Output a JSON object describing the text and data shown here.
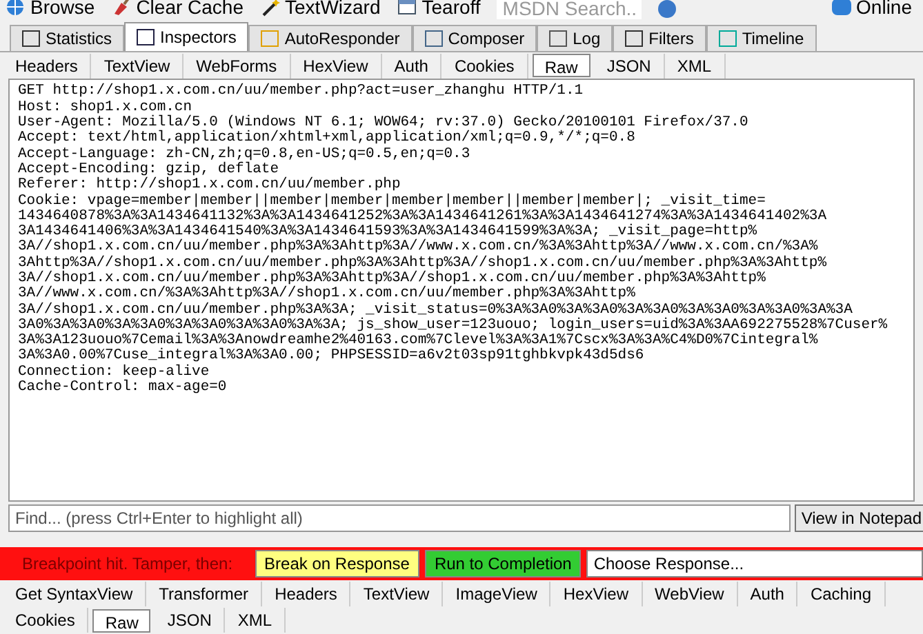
{
  "toolbar": [
    {
      "label": "Browse",
      "kind": "globe"
    },
    {
      "label": "Clear Cache",
      "kind": "broom"
    },
    {
      "label": "TextWizard",
      "kind": "wand"
    },
    {
      "label": "Tearoff",
      "kind": "window"
    }
  ],
  "search": {
    "placeholder": "MSDN Search..."
  },
  "online": {
    "label": "Online"
  },
  "main_tabs": [
    {
      "label": "Statistics",
      "selected": false
    },
    {
      "label": "Inspectors",
      "selected": true
    },
    {
      "label": "AutoResponder",
      "selected": false
    },
    {
      "label": "Composer",
      "selected": false
    },
    {
      "label": "Log",
      "selected": false
    },
    {
      "label": "Filters",
      "selected": false
    },
    {
      "label": "Timeline",
      "selected": false
    }
  ],
  "request_tabs": [
    {
      "label": "Headers",
      "selected": false
    },
    {
      "label": "TextView",
      "selected": false
    },
    {
      "label": "WebForms",
      "selected": false
    },
    {
      "label": "HexView",
      "selected": false
    },
    {
      "label": "Auth",
      "selected": false
    },
    {
      "label": "Cookies",
      "selected": false
    },
    {
      "label": "Raw",
      "selected": true
    },
    {
      "label": "JSON",
      "selected": false
    },
    {
      "label": "XML",
      "selected": false
    }
  ],
  "raw_lines": [
    "GET http://shop1.x.com.cn/uu/member.php?act=user_zhanghu HTTP/1.1",
    "Host: shop1.x.com.cn",
    "User-Agent: Mozilla/5.0 (Windows NT 6.1; WOW64; rv:37.0) Gecko/20100101 Firefox/37.0",
    "Accept: text/html,application/xhtml+xml,application/xml;q=0.9,*/*;q=0.8",
    "Accept-Language: zh-CN,zh;q=0.8,en-US;q=0.5,en;q=0.3",
    "Accept-Encoding: gzip, deflate",
    "Referer: http://shop1.x.com.cn/uu/member.php",
    "Cookie: vpage=member|member||member|member|member|member||member|member|; _visit_time=",
    "1434640878%3A%3A1434641132%3A%3A1434641252%3A%3A1434641261%3A%3A1434641274%3A%3A1434641402%3A",
    "3A1434641406%3A%3A1434641540%3A%3A1434641593%3A%3A1434641599%3A%3A; _visit_page=http%",
    "3A//shop1.x.com.cn/uu/member.php%3A%3Ahttp%3A//www.x.com.cn/%3A%3Ahttp%3A//www.x.com.cn/%3A%",
    "3Ahttp%3A//shop1.x.com.cn/uu/member.php%3A%3Ahttp%3A//shop1.x.com.cn/uu/member.php%3A%3Ahttp%",
    "3A//shop1.x.com.cn/uu/member.php%3A%3Ahttp%3A//shop1.x.com.cn/uu/member.php%3A%3Ahttp%",
    "3A//www.x.com.cn/%3A%3Ahttp%3A//shop1.x.com.cn/uu/member.php%3A%3Ahttp%",
    "3A//shop1.x.com.cn/uu/member.php%3A%3A; _visit_status=0%3A%3A0%3A%3A0%3A%3A0%3A%3A0%3A%3A0%3A%3A",
    "3A0%3A%3A0%3A%3A0%3A%3A0%3A%3A0%3A%3A; js_show_user=123uouo; login_users=uid%3A%3AA692275528%7Cuser%",
    "3A%3A123uouo%7Cemail%3A%3Anowdreamhe2%40163.com%7Clevel%3A%3A1%7Cscx%3A%3A%C4%D0%7Cintegral%",
    "3A%3A0.00%7Cuse_integral%3A%3A0.00; PHPSESSID=a6v2t03sp91tghbkvpk43d5ds6",
    "Connection: keep-alive",
    "Cache-Control: max-age=0"
  ],
  "find": {
    "placeholder": "Find... (press Ctrl+Enter to highlight all)"
  },
  "view_in_notepad": "View in Notepad",
  "breakpoint": {
    "message": "Breakpoint hit. Tamper, then:",
    "buttons": [
      {
        "label": "Break on Response",
        "kind": "yellow"
      },
      {
        "label": "Run to Completion",
        "kind": "green"
      }
    ],
    "response_select": "Choose Response..."
  },
  "response_tabs": [
    [
      {
        "label": "Get SyntaxView",
        "selected": false
      },
      {
        "label": "Transformer",
        "selected": false
      },
      {
        "label": "Headers",
        "selected": false
      },
      {
        "label": "TextView",
        "selected": false
      },
      {
        "label": "ImageView",
        "selected": false
      },
      {
        "label": "HexView",
        "selected": false
      },
      {
        "label": "WebView",
        "selected": false
      },
      {
        "label": "Auth",
        "selected": false
      },
      {
        "label": "Caching",
        "selected": false
      }
    ],
    [
      {
        "label": "Cookies",
        "selected": false
      },
      {
        "label": "Raw",
        "selected": true
      },
      {
        "label": "JSON",
        "selected": false
      },
      {
        "label": "XML",
        "selected": false
      }
    ]
  ]
}
